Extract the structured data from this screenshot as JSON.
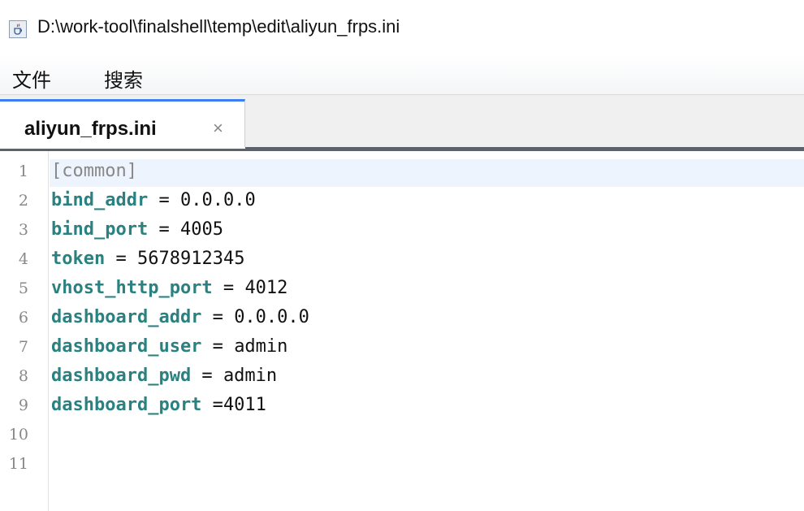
{
  "window": {
    "title": "D:\\work-tool\\finalshell\\temp\\edit\\aliyun_frps.ini",
    "icon": "java-cup-icon"
  },
  "menu": {
    "items": [
      "文件",
      "搜索"
    ]
  },
  "tabs": [
    {
      "label": "aliyun_frps.ini",
      "close": "×",
      "active": true
    }
  ],
  "editor": {
    "current_line": 1,
    "lines": [
      {
        "number": "1",
        "section": "[common]"
      },
      {
        "number": "2",
        "key": "bind_addr",
        "sep": " = ",
        "value": "0.0.0.0"
      },
      {
        "number": "3",
        "key": "bind_port",
        "sep": " = ",
        "value": "4005"
      },
      {
        "number": "4",
        "key": "token",
        "sep": " = ",
        "value": "5678912345"
      },
      {
        "number": "5",
        "key": "vhost_http_port",
        "sep": " = ",
        "value": "4012"
      },
      {
        "number": "6",
        "key": "dashboard_addr",
        "sep": " = ",
        "value": "0.0.0.0"
      },
      {
        "number": "7",
        "key": "dashboard_user",
        "sep": " = ",
        "value": "admin"
      },
      {
        "number": "8",
        "key": "dashboard_pwd",
        "sep": " = ",
        "value": "admin"
      },
      {
        "number": "9",
        "key": "dashboard_port",
        "sep": " =",
        "value": "4011"
      },
      {
        "number": "10"
      },
      {
        "number": "11"
      }
    ]
  },
  "colors": {
    "key": "#2b8080",
    "section": "#888888",
    "tab_accent": "#3c7ff0",
    "current_line_bg": "#eef4fd"
  }
}
